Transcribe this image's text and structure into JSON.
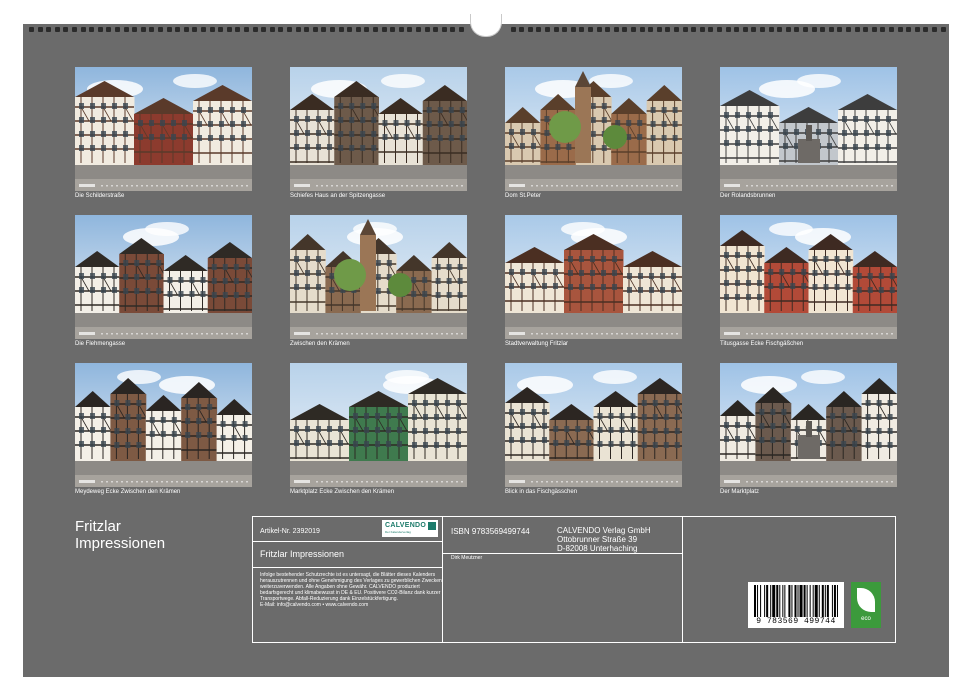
{
  "calendar": {
    "title_line1": "Fritzlar",
    "title_line2": "Impressionen"
  },
  "photos": [
    {
      "caption": "Die Schilderstraße",
      "scene": "half-timbered street"
    },
    {
      "caption": "Schiefes Haus an der Spitzengasse",
      "scene": "leaning half-timbered house"
    },
    {
      "caption": "Dom St.Peter",
      "scene": "cathedral"
    },
    {
      "caption": "Der Rolandsbrunnen",
      "scene": "market fountain"
    },
    {
      "caption": "Die Flehmengasse",
      "scene": "narrow lane"
    },
    {
      "caption": "Zwischen den Krämen",
      "scene": "square with church at sunset"
    },
    {
      "caption": "Stadtverwaltung Fritzlar",
      "scene": "town hall"
    },
    {
      "caption": "Titusgasse Ecke Fischgäßchen",
      "scene": "red half-timbered building"
    },
    {
      "caption": "Meydeweg Ecke Zwischen den Krämen",
      "scene": "half-timbered corner house"
    },
    {
      "caption": "Marktplatz Ecke Zwischen den Krämen",
      "scene": "green half-timbered house"
    },
    {
      "caption": "Blick in das Fischgässchen",
      "scene": "half-timbered gable"
    },
    {
      "caption": "Der Marktplatz",
      "scene": "market square"
    }
  ],
  "info": {
    "article": "Artikel-Nr. 2392019",
    "publisher_logo": "CALVENDO",
    "publisher_logo_sub": "Der Kalenderverlag",
    "product_title": "Fritzlar Impressionen",
    "legal_text": "Infolge bestehender Schutzrechte ist es untersagt, die Blätter dieses Kalenders herauszutrennen und ohne Genehmigung des Verlages zu gewerblichen Zwecken weiterzuverwenden. Alle Angaben ohne Gewähr. CALVENDO produziert bedarfsgerecht und klimabewusst in DE & EU. Positivere CO2-Bilanz dank kurzer Transportwege. Abfall-Reduzierung dank Einzelstückfertigung.",
    "contact": "E-Mail: info@calvendo.com • www.calvendo.com",
    "isbn": "ISBN 9783569499744",
    "author": "Dirk Meutzner",
    "address_line1": "CALVENDO Verlag GmbH",
    "address_line2": "Ottobrunner Straße 39",
    "address_line3": "D-82008 Unterhaching",
    "barcode_number": "9 783569 499744",
    "eco_label": "eco"
  },
  "colors": {
    "page_background": "#6b6b6b",
    "text": "#ffffff",
    "eco_green": "#3c9a3c",
    "logo_teal": "#1c7b6b"
  }
}
